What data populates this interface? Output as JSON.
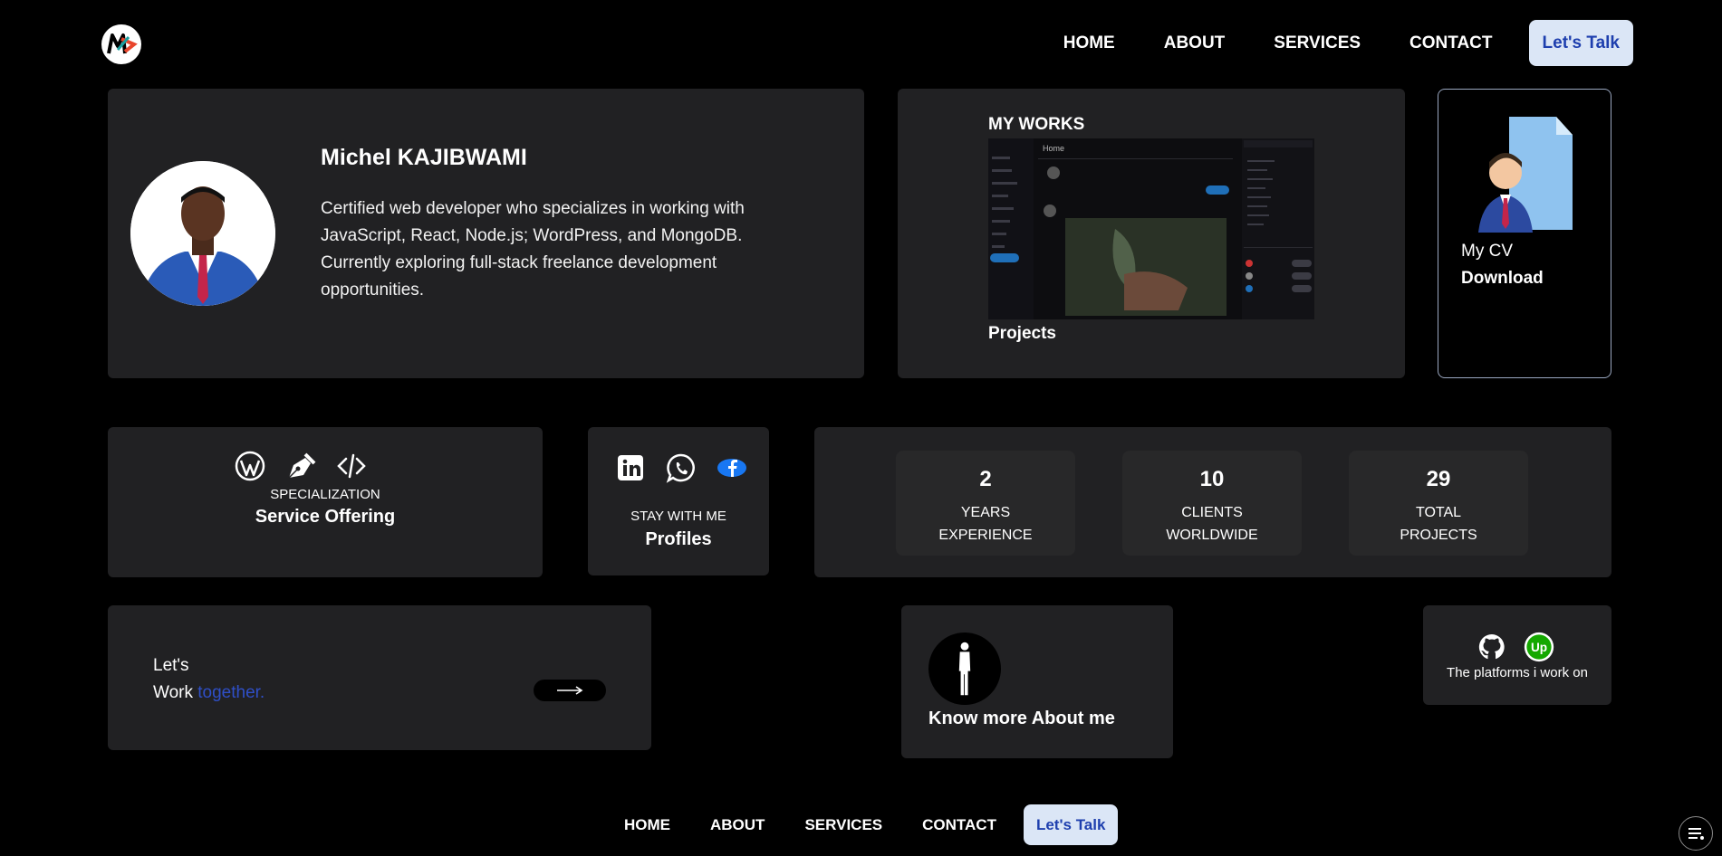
{
  "header": {
    "logo_icon": "logo-icon",
    "nav": [
      "HOME",
      "ABOUT",
      "SERVICES",
      "CONTACT"
    ],
    "cta": "Let's Talk"
  },
  "hero": {
    "name": "Michel KAJIBWAMI",
    "bio": "Certified web developer who specializes in working with JavaScript, React, Node.js; WordPress, and MongoDB. Currently exploring full-stack freelance development opportunities.",
    "avatar_icon": "profile-photo"
  },
  "works": {
    "title": "MY WORKS",
    "label": "Projects",
    "preview_heading": "Home"
  },
  "cv": {
    "title": "My CV",
    "action": "Download",
    "icon": "cv-document-icon"
  },
  "service": {
    "icons": [
      "wordpress-icon",
      "pen-tool-icon",
      "code-icon"
    ],
    "small": "SPECIALIZATION",
    "big": "Service Offering"
  },
  "profiles": {
    "icons": [
      "linkedin-icon",
      "whatsapp-icon",
      "facebook-icon"
    ],
    "small": "STAY WITH ME",
    "big": "Profiles"
  },
  "stats": [
    {
      "num": "2",
      "line1": "YEARS",
      "line2": "EXPERIENCE"
    },
    {
      "num": "10",
      "line1": "CLIENTS",
      "line2": "WORLDWIDE"
    },
    {
      "num": "29",
      "line1": "TOTAL",
      "line2": "PROJECTS"
    }
  ],
  "together": {
    "line1": "Let's",
    "line2_word": "Work",
    "line2_accent": "together.",
    "accent_color": "#2f4fc7"
  },
  "about": {
    "text": "Know more About me",
    "icon": "person-standing-icon"
  },
  "platforms": {
    "icons": [
      "github-icon",
      "upwork-icon"
    ],
    "text": "The platforms i work on"
  },
  "footer": {
    "nav": [
      "HOME",
      "ABOUT",
      "SERVICES",
      "CONTACT"
    ],
    "cta": "Let's Talk"
  },
  "colors": {
    "background": "#000000",
    "card": "#212123",
    "cta_bg": "#dbe6f6",
    "cta_text": "#1e3fae"
  }
}
